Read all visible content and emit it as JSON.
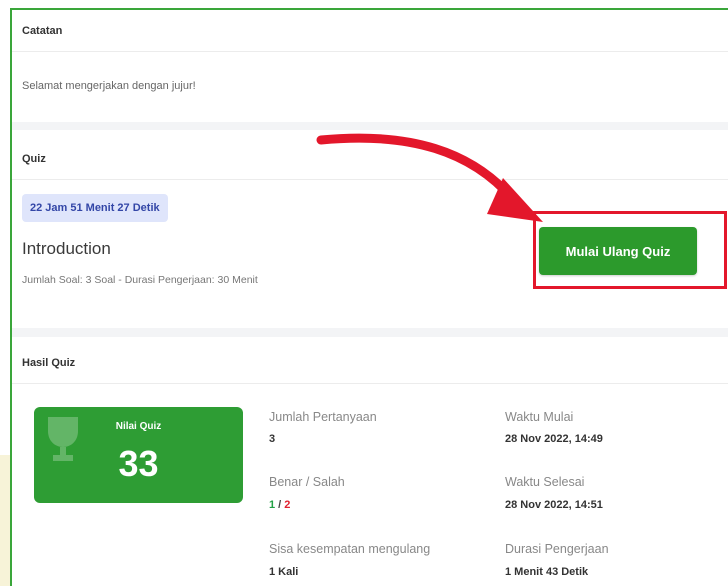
{
  "notes": {
    "header": "Catatan",
    "text": "Selamat mengerjakan dengan jujur!"
  },
  "quiz": {
    "header": "Quiz",
    "timer": "22 Jam 51 Menit 27 Detik",
    "title": "Introduction",
    "meta": "Jumlah Soal: 3 Soal - Durasi Pengerjaan: 30 Menit",
    "start_button": "Mulai Ulang Quiz"
  },
  "result": {
    "header": "Hasil Quiz",
    "score_label": "Nilai Quiz",
    "score_value": "33",
    "questions_label": "Jumlah Pertanyaan",
    "questions_value": "3",
    "correct_wrong_label": "Benar / Salah",
    "correct_value": "1",
    "separator": " / ",
    "wrong_value": "2",
    "remaining_label": "Sisa kesempatan mengulang",
    "remaining_value": "1 Kali",
    "start_time_label": "Waktu Mulai",
    "start_time_value": "28 Nov 2022, 14:49",
    "end_time_label": "Waktu Selesai",
    "end_time_value": "28 Nov 2022, 14:51",
    "duration_label": "Durasi Pengerjaan",
    "duration_value": "1 Menit 43 Detik"
  },
  "colors": {
    "accent_green": "#2c9a2c",
    "highlight_red": "#e3172b",
    "timer_bg": "#dfe5fb",
    "timer_text": "#3346a7"
  }
}
